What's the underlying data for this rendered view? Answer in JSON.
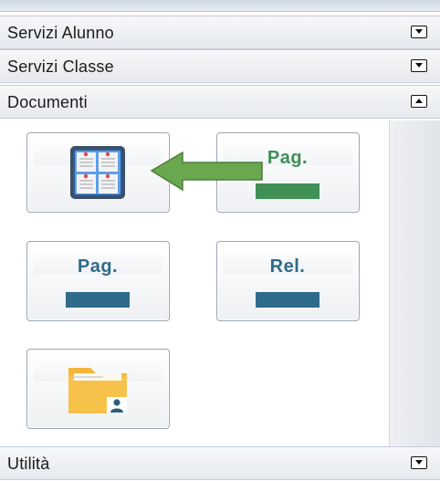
{
  "accordion": {
    "sections": [
      {
        "label": "Servizi Alunno",
        "state": "collapsed"
      },
      {
        "label": "Servizi Classe",
        "state": "collapsed"
      },
      {
        "label": "Documenti",
        "state": "expanded"
      },
      {
        "label": "Utilità",
        "state": "collapsed"
      }
    ]
  },
  "documenti": {
    "tiles": [
      {
        "icon": "bulletin-board-icon",
        "label": ""
      },
      {
        "icon": "page-green-icon",
        "label": "Pag.",
        "color": "#3f8f56"
      },
      {
        "icon": "page-blue-icon",
        "label": "Pag.",
        "color": "#2f6b8a"
      },
      {
        "icon": "report-blue-icon",
        "label": "Rel.",
        "color": "#2f6b8a"
      },
      {
        "icon": "folder-user-icon",
        "label": ""
      }
    ]
  },
  "colors": {
    "accent_green": "#6aa84f",
    "blue_badge": "#2f6b8a",
    "green_badge": "#3f8f56",
    "folder_yellow": "#f6c24a"
  }
}
